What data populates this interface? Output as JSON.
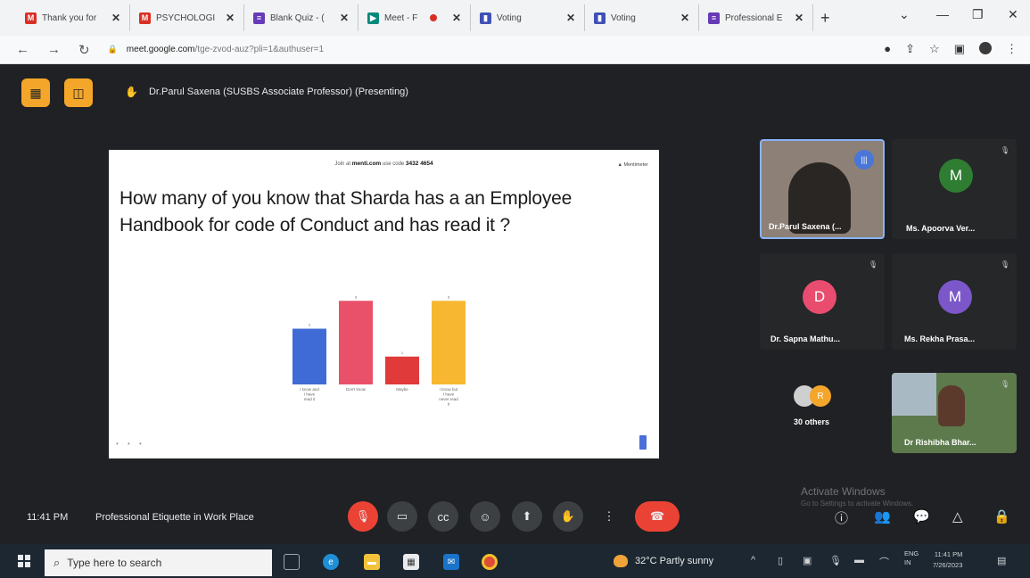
{
  "browser": {
    "tabs": [
      {
        "title": "Thank you for",
        "icon": "gmail-icon",
        "color": "#d93025"
      },
      {
        "title": "PSYCHOLOGI",
        "icon": "gmail-icon",
        "color": "#d93025"
      },
      {
        "title": "Blank Quiz - (",
        "icon": "forms-icon",
        "color": "#673ab7"
      },
      {
        "title": "Meet - F",
        "icon": "meet-icon",
        "color": "#00897b"
      },
      {
        "title": "Voting",
        "icon": "menti-icon",
        "color": "#3f51b5"
      },
      {
        "title": "Voting",
        "icon": "menti-icon",
        "color": "#3f51b5"
      },
      {
        "title": "Professional E",
        "icon": "forms-icon",
        "color": "#673ab7"
      }
    ],
    "url_host": "meet.google.com",
    "url_path": "/tge-zvod-auz?pli=1&authuser=1"
  },
  "meet": {
    "presenter": "Dr.Parul Saxena (SUSBS Associate Professor) (Presenting)",
    "clock": "11:41 PM",
    "meeting_name": "Professional Etiquette in Work Place",
    "watermark": "Activate Windows",
    "watermark_sub": "Go to Settings to activate Windows.",
    "participants": [
      {
        "name": "Dr.Parul Saxena (...",
        "type": "video"
      },
      {
        "name": "Ms. Apoorva Ver...",
        "initial": "M",
        "color": "#2e7d32"
      },
      {
        "name": "Dr. Sapna Mathu...",
        "initial": "D",
        "color": "#e84c6e"
      },
      {
        "name": "Ms. Rekha Prasa...",
        "initial": "M",
        "color": "#7b57c9"
      },
      {
        "name": "30 others",
        "type": "group",
        "initial": "R",
        "color": "#f4a62a"
      },
      {
        "name": "Dr Rishibha Bhar...",
        "type": "video"
      }
    ]
  },
  "slide": {
    "join_prefix": "Join at",
    "join_site": "menti.com",
    "join_code_label": "use code",
    "join_code": "3432 4654",
    "brand": "Mentimeter",
    "question": "How many of you know that Sharda has a an Employee Handbook for code of Conduct and has read it ?"
  },
  "chart_data": {
    "type": "bar",
    "categories": [
      "I know and I have read it",
      "Don't know",
      "Maybe",
      "I know but I have never read it"
    ],
    "values": [
      2,
      3,
      1,
      3
    ],
    "colors": [
      "#3f6bd6",
      "#e9506a",
      "#e03a3a",
      "#f7b731"
    ],
    "ylim": [
      0,
      3.2
    ],
    "data_labels": [
      "2",
      "3",
      "1",
      "3"
    ]
  },
  "taskbar": {
    "search_placeholder": "Type here to search",
    "weather": "32°C  Partly sunny",
    "lang_top": "ENG",
    "lang_bottom": "IN",
    "time": "11:41 PM",
    "date": "7/26/2023"
  }
}
